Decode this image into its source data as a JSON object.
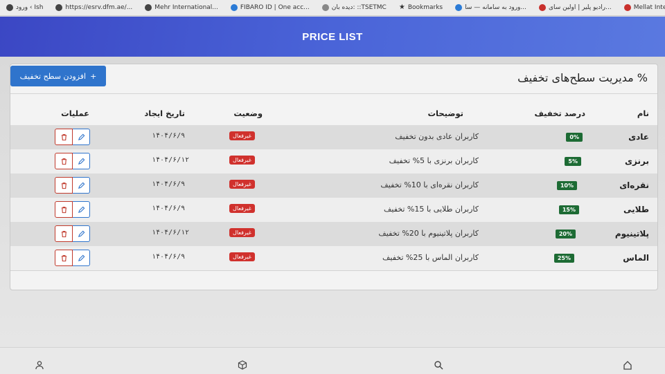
{
  "bookmarks": [
    {
      "label": "ورود ‹ Ish",
      "icon": "link-icon"
    },
    {
      "label": "https://esrv.dfm.ae/...",
      "icon": "github-icon"
    },
    {
      "label": "Mehr International...",
      "icon": "globe-icon"
    },
    {
      "label": "FIBARO ID | One acc...",
      "icon": "fibaro-icon"
    },
    {
      "label": "دیده بان: ::TSETMC",
      "icon": "globe-icon"
    },
    {
      "label": "Bookmarks",
      "icon": "star-icon"
    },
    {
      "label": "ورود به سامانه — سا...",
      "icon": "globe-icon"
    },
    {
      "label": "رادیو پلیر | اولین سای...",
      "icon": "red-icon"
    },
    {
      "label": "Mellat Internet Bank...",
      "icon": "bank-icon"
    }
  ],
  "header": {
    "title": "PRICE LIST"
  },
  "card": {
    "title": "% مدیریت سطح‌های تخفیف",
    "add_button": "افزودن سطح تخفیف",
    "add_icon": "+"
  },
  "table": {
    "headers": {
      "name": "نام",
      "discount": "درصد تخفیف",
      "description": "توضیحات",
      "status": "وضعیت",
      "created": "تاریخ ایجاد",
      "actions": "عملیات"
    },
    "rows": [
      {
        "name": "عادی",
        "discount": "0%",
        "description": "کاربران عادی بدون تخفیف",
        "status": "غیرفعال",
        "created": "۱۴۰۴/۶/۹"
      },
      {
        "name": "برنزی",
        "discount": "5%",
        "description": "کاربران برنزی با 5% تخفیف",
        "status": "غیرفعال",
        "created": "۱۴۰۴/۶/۱۲"
      },
      {
        "name": "نقره‌ای",
        "discount": "10%",
        "description": "کاربران نقره‌ای با 10% تخفیف",
        "status": "غیرفعال",
        "created": "۱۴۰۴/۶/۹"
      },
      {
        "name": "طلایی",
        "discount": "15%",
        "description": "کاربران طلایی با 15% تخفیف",
        "status": "غیرفعال",
        "created": "۱۴۰۴/۶/۹"
      },
      {
        "name": "پلاتینیوم",
        "discount": "20%",
        "description": "کاربران پلاتینیوم با 20% تخفیف",
        "status": "غیرفعال",
        "created": "۱۴۰۴/۶/۱۲"
      },
      {
        "name": "الماس",
        "discount": "25%",
        "description": "کاربران الماس با 25% تخفیف",
        "status": "غیرفعال",
        "created": "۱۴۰۴/۶/۹"
      }
    ]
  },
  "colors": {
    "header_gradient_start": "#3b47c4",
    "header_gradient_end": "#5a79e0",
    "primary": "#2f74cc",
    "discount_badge": "#1d6b34",
    "status_badge": "#d0312d"
  },
  "bottom_nav": [
    "user-icon",
    "cube-icon",
    "search-icon",
    "home-icon"
  ]
}
